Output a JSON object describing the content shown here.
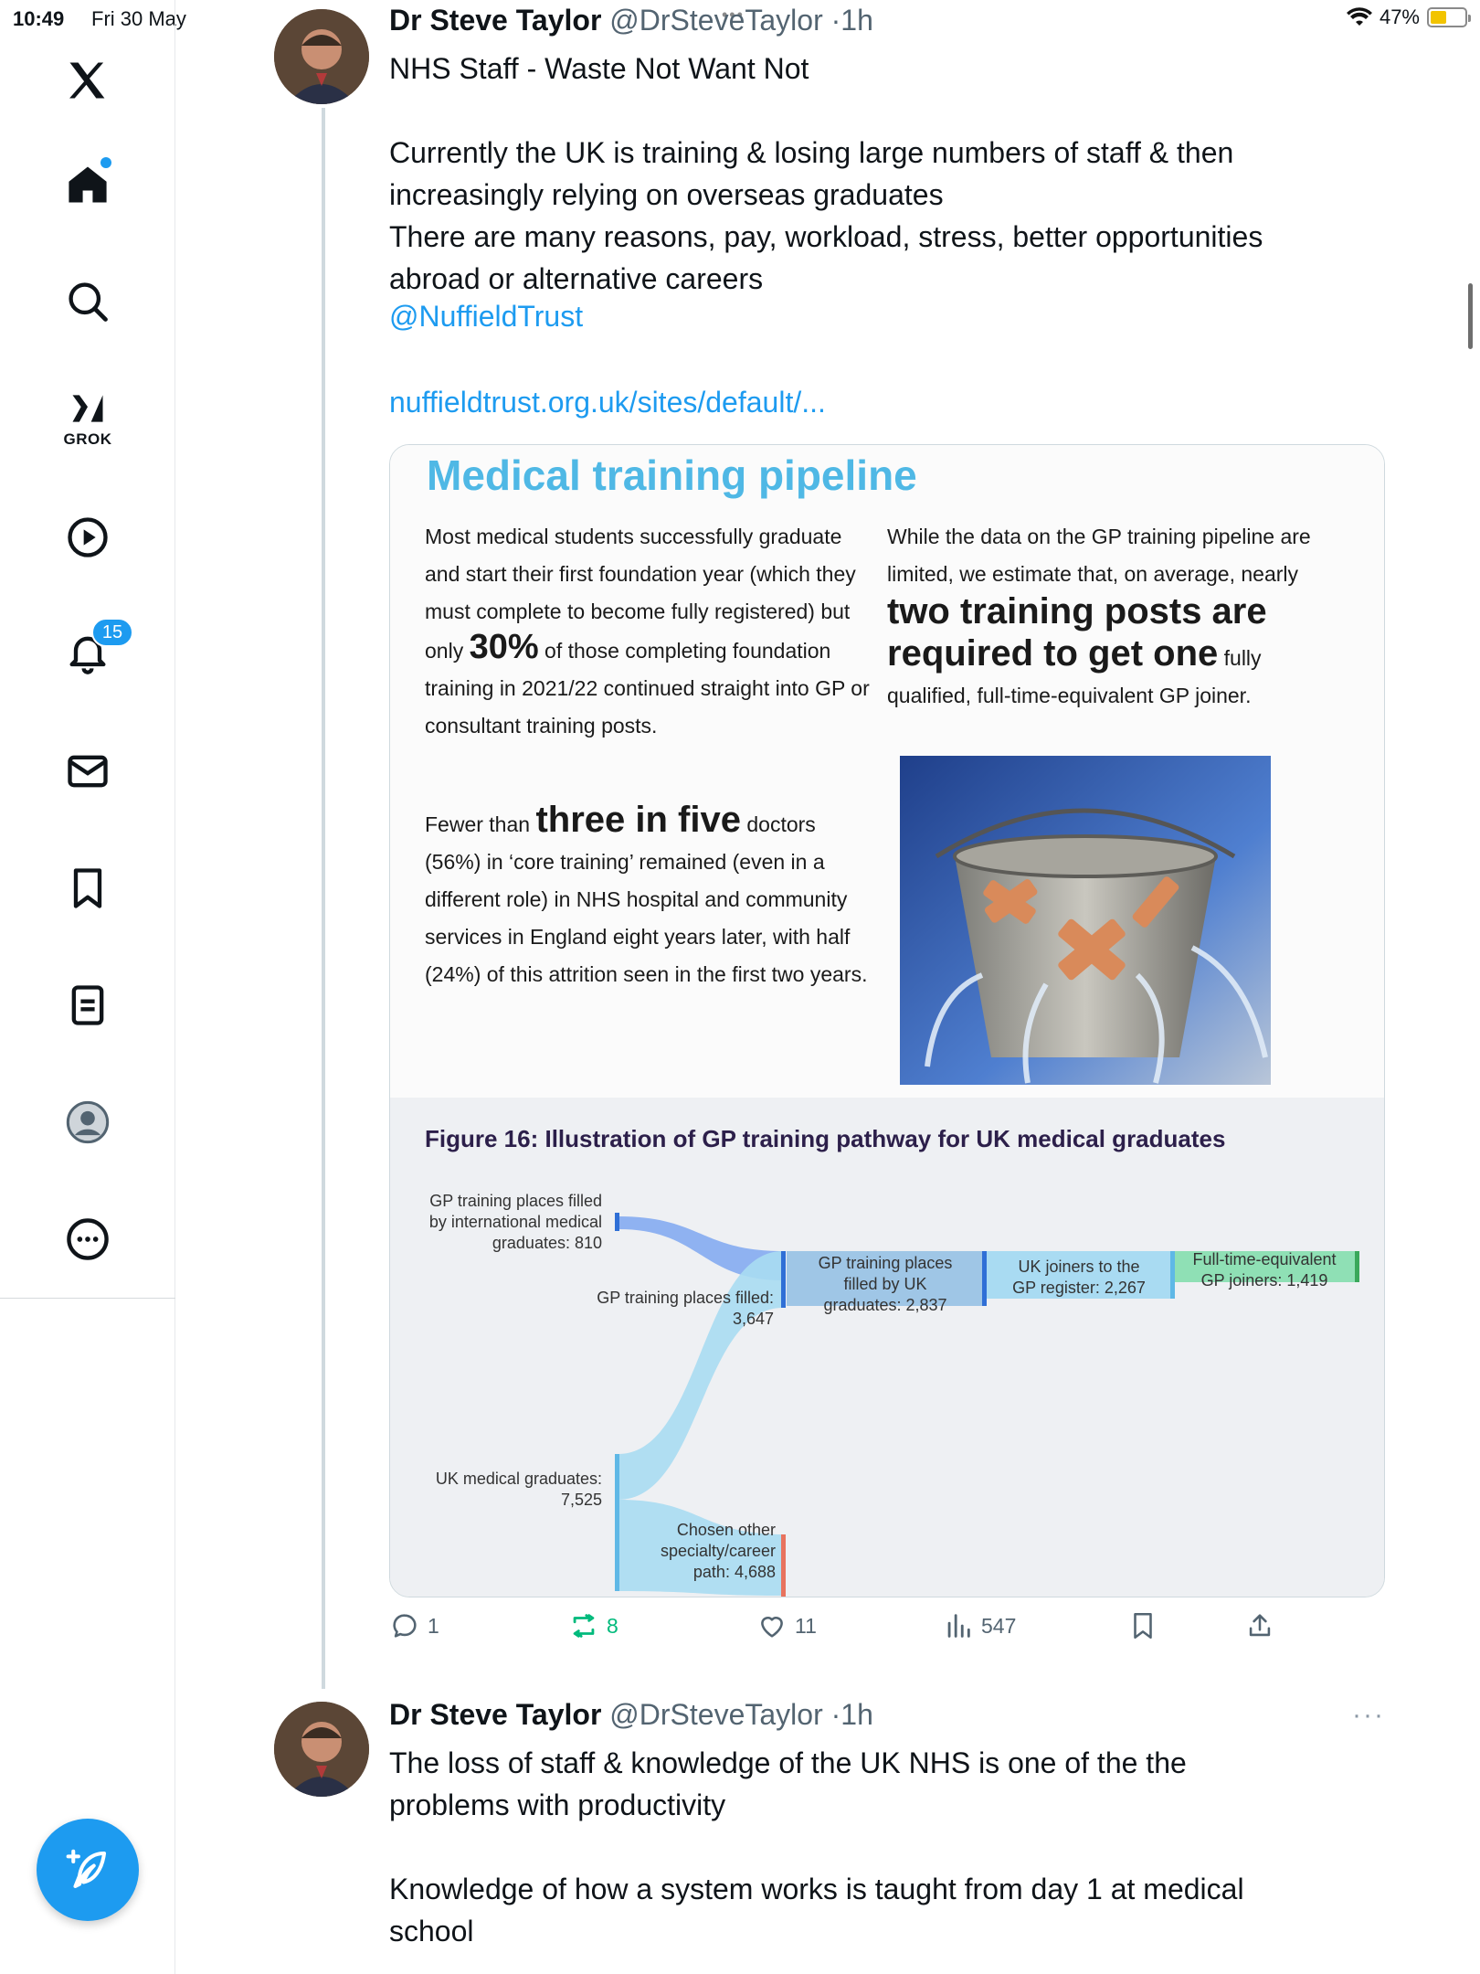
{
  "status_bar": {
    "time": "10:49",
    "date": "Fri 30 May",
    "battery": "47%",
    "battery_level": 0.47
  },
  "sidebar": {
    "items": [
      {
        "name": "x-logo",
        "label": ""
      },
      {
        "name": "home",
        "label": ""
      },
      {
        "name": "search",
        "label": ""
      },
      {
        "name": "grok",
        "label": "GROK"
      },
      {
        "name": "videos",
        "label": ""
      },
      {
        "name": "notifications",
        "label": "",
        "badge": "15"
      },
      {
        "name": "messages",
        "label": ""
      },
      {
        "name": "bookmarks",
        "label": ""
      },
      {
        "name": "lists",
        "label": ""
      },
      {
        "name": "profile",
        "label": ""
      },
      {
        "name": "more",
        "label": ""
      }
    ],
    "notification_badge": "15"
  },
  "posts": [
    {
      "author": "Dr Steve Taylor",
      "handle": "@DrSteveTaylor",
      "time": "1h",
      "title": "NHS Staff - Waste Not Want Not",
      "body": "Currently the UK is training & losing large numbers of staff & then\nincreasingly relying on overseas graduates\nThere are many reasons, pay, workload, stress, better opportunities\nabroad or alternative careers",
      "mention": "@NuffieldTrust",
      "link": "nuffieldtrust.org.uk/sites/default/...",
      "stats": {
        "replies": "1",
        "reposts": "8",
        "likes": "11",
        "views": "547"
      }
    },
    {
      "author": "Dr Steve Taylor",
      "handle": "@DrSteveTaylor",
      "time": "1h",
      "body": "The loss of staff & knowledge of the UK NHS is one of the the\nproblems with productivity\n\nKnowledge of how a system works is taught from day 1 at medical\nschool",
      "more": "···"
    }
  ],
  "infographic": {
    "title": "Medical training pipeline",
    "left_p1_a": "Most medical students successfully graduate and start their first foundation year (which they must complete to become fully registered) but only ",
    "left_p1_big": "30%",
    "left_p1_b": " of those completing foundation training in 2021/22 continued straight into GP or consultant training posts.",
    "left_p2_a": "Fewer than ",
    "left_p2_big": "three in five",
    "left_p2_b": " doctors (56%) in ‘core training’ remained (even in a different role) in NHS hospital and community services in England eight years later, with half (24%) of this attrition seen in the first two years.",
    "right_p_a": "While the data on the GP training pipeline are limited, we estimate that, on average, nearly ",
    "right_p_big": "two training posts are required to get one",
    "right_p_b": " fully qualified, full-time-equivalent GP joiner."
  },
  "figure": {
    "title": "Figure 16: Illustration of GP training pathway for UK medical graduates",
    "nodes": {
      "img": "GP training places filled\nby international medical\ngraduates: 810",
      "filled": "GP training places filled:\n3,647",
      "uk_grads": "UK medical graduates:\n7,525",
      "uk_filled": "GP training places\nfilled by UK\ngraduates: 2,837",
      "joiners": "UK joiners to the\nGP register: 2,267",
      "fte": "Full-time-equivalent\nGP joiners: 1,419",
      "other": "Chosen other\nspecialty/career\npath: 4,688"
    },
    "colors": {
      "imgs": "#7ea7f0",
      "uk": "#a9dbf2",
      "node_blue": "#2f6fd6",
      "other": "#e8735e",
      "fte": "#5cc98a"
    }
  }
}
